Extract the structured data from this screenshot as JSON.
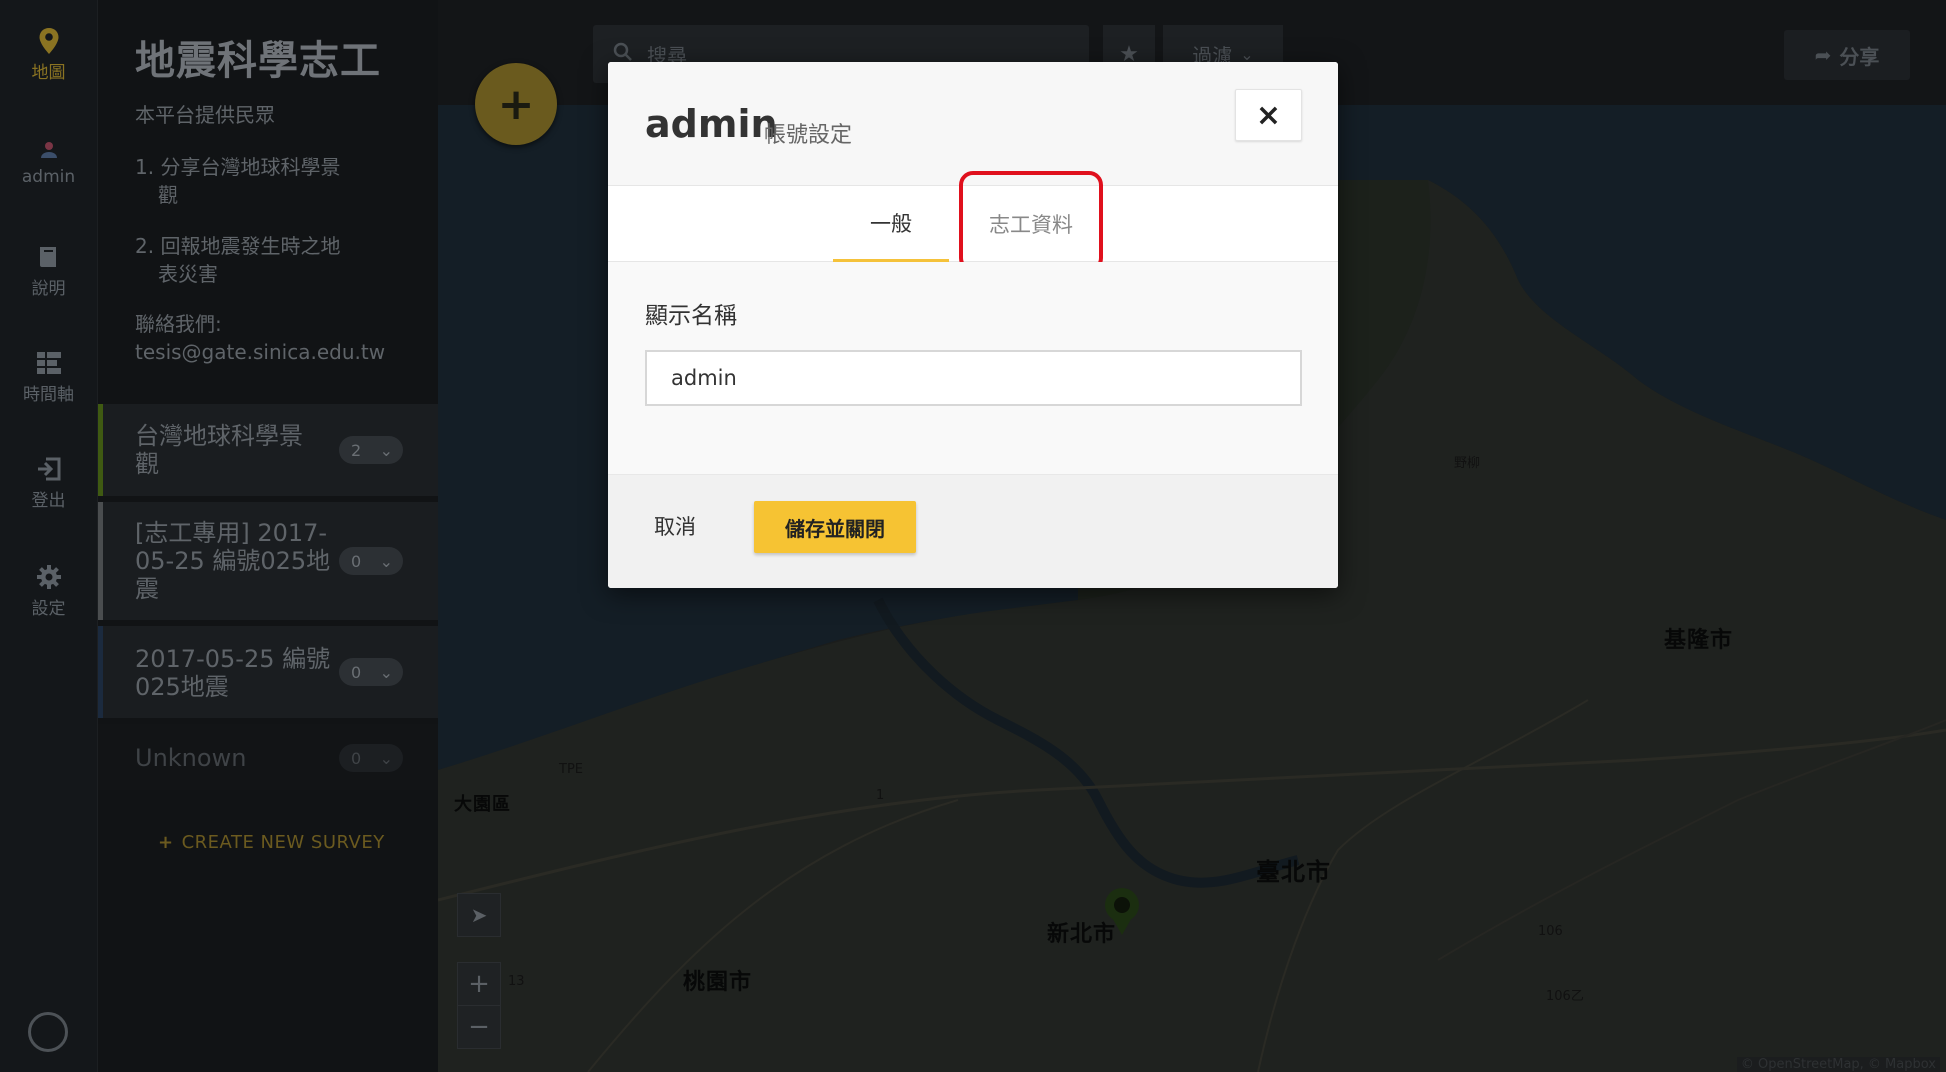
{
  "rail": {
    "items": [
      {
        "label": "地圖",
        "icon": "map-pin-icon"
      },
      {
        "label": "admin",
        "icon": "user-icon"
      },
      {
        "label": "說明",
        "icon": "book-icon"
      },
      {
        "label": "時間軸",
        "icon": "timeline-icon"
      },
      {
        "label": "登出",
        "icon": "logout-icon"
      },
      {
        "label": "設定",
        "icon": "gear-icon"
      }
    ]
  },
  "sidebar": {
    "title": "地震科學志工",
    "intro": "本平台提供民眾",
    "list_1a": "1. 分享台灣地球科學景",
    "list_1b": "觀",
    "list_2a": "2. 回報地震發生時之地",
    "list_2b": "表災害",
    "contact_label": "聯絡我們:",
    "contact_email": "tesis@gate.sinica.edu.tw",
    "surveys": [
      {
        "name_1": "台灣地球科學景",
        "name_2": "觀",
        "count": "2",
        "color": "#3f5a12"
      },
      {
        "name_1": "[志工專用] 2017-",
        "name_2": "05-25 編號025地",
        "name_3": "震",
        "count": "0",
        "color": "#4a4d4f"
      },
      {
        "name_1": "2017-05-25 編號",
        "name_2": "025地震",
        "count": "0",
        "color": "#1b2a3e"
      },
      {
        "name_1": "Unknown",
        "count": "0",
        "color": "#111315"
      }
    ],
    "create_label": "CREATE NEW SURVEY"
  },
  "topbar": {
    "search_placeholder": "搜尋",
    "filter_label": "過濾",
    "share_label": "分享"
  },
  "map": {
    "labels": {
      "keelung": "基隆市",
      "taipei": "臺北市",
      "newtaipei": "新北市",
      "taoyuan_city": "桃園市",
      "dayuan": "大園區",
      "tpe": "TPE",
      "yeliu": "野柳",
      "route1": "1",
      "route106": "106",
      "route106b": "106乙",
      "route13": "13"
    },
    "attribution": "© OpenStreetMap, © Mapbox"
  },
  "modal": {
    "title": "admin",
    "subtitle": "帳號設定",
    "close": "×",
    "tabs": [
      "一般",
      "志工資料"
    ],
    "field_label": "顯示名稱",
    "field_value": "admin",
    "cancel": "取消",
    "save": "儲存並關閉"
  },
  "colors": {
    "accent": "#f5c23a",
    "highlight": "#e0101d"
  }
}
